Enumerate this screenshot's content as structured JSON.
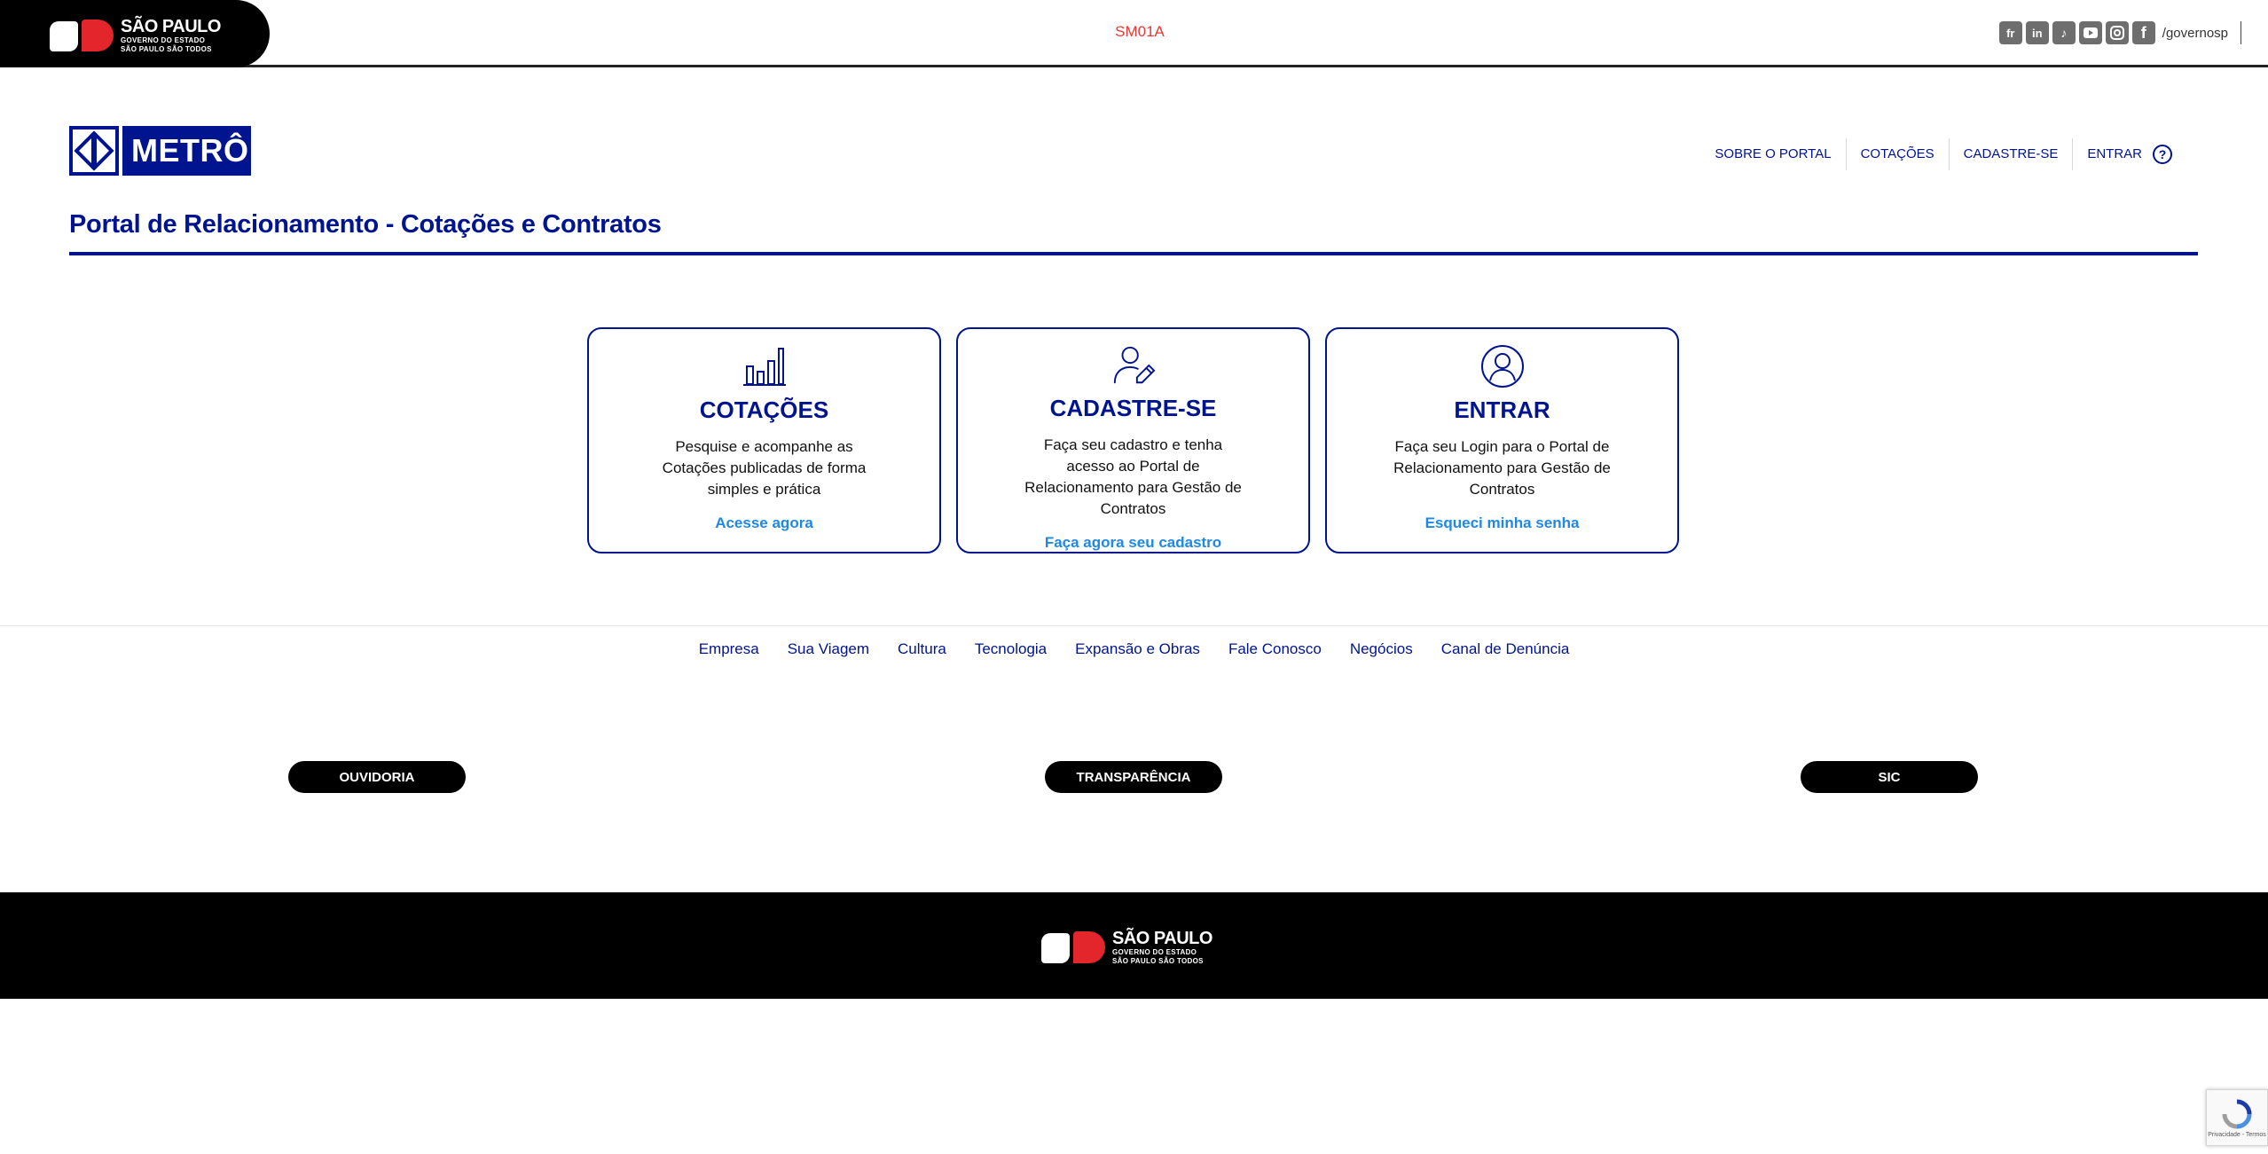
{
  "gov_header": {
    "logo": {
      "line1": "SÃO PAULO",
      "line2": "GOVERNO DO ESTADO",
      "line3": "SÃO PAULO SÃO TODOS"
    },
    "env_code": "SM01A",
    "social": {
      "icons": [
        "flickr-icon",
        "linkedin-icon",
        "tiktok-icon",
        "youtube-icon",
        "instagram-icon",
        "facebook-icon"
      ],
      "handle": "/governosp"
    }
  },
  "metro": {
    "logo_text": "METRÔ",
    "nav": [
      "SOBRE O PORTAL",
      "COTAÇÕES",
      "CADASTRE-SE",
      "ENTRAR"
    ],
    "help_glyph": "?"
  },
  "page": {
    "title": "Portal de Relacionamento - Cotações e Contratos"
  },
  "cards": [
    {
      "icon": "bar-chart-icon",
      "title": "COTAÇÕES",
      "description": "Pesquise e acompanhe as Cotações publicadas de forma simples e prática",
      "link": "Acesse agora"
    },
    {
      "icon": "user-edit-icon",
      "title": "CADASTRE-SE",
      "description": "Faça seu cadastro e tenha acesso ao Portal de Relacionamento para Gestão de Contratos",
      "link": "Faça agora seu cadastro"
    },
    {
      "icon": "user-circle-icon",
      "title": "ENTRAR",
      "description": "Faça seu Login para o Portal de Relacionamento para Gestão de Contratos",
      "link": "Esqueci minha senha"
    }
  ],
  "footer": {
    "links": [
      "Empresa",
      "Sua Viagem",
      "Cultura",
      "Tecnologia",
      "Expansão e Obras",
      "Fale Conosco",
      "Negócios",
      "Canal de Denúncia"
    ],
    "buttons": [
      "OUVIDORIA",
      "TRANSPARÊNCIA",
      "SIC"
    ],
    "logo": {
      "line1": "SÃO PAULO",
      "line2": "GOVERNO DO ESTADO",
      "line3": "SÃO PAULO SÃO TODOS"
    }
  },
  "recaptcha": {
    "text": "Privacidade - Termos"
  },
  "colors": {
    "primary": "#00148f",
    "link": "#1e88e5",
    "accent_red": "#e53935"
  }
}
